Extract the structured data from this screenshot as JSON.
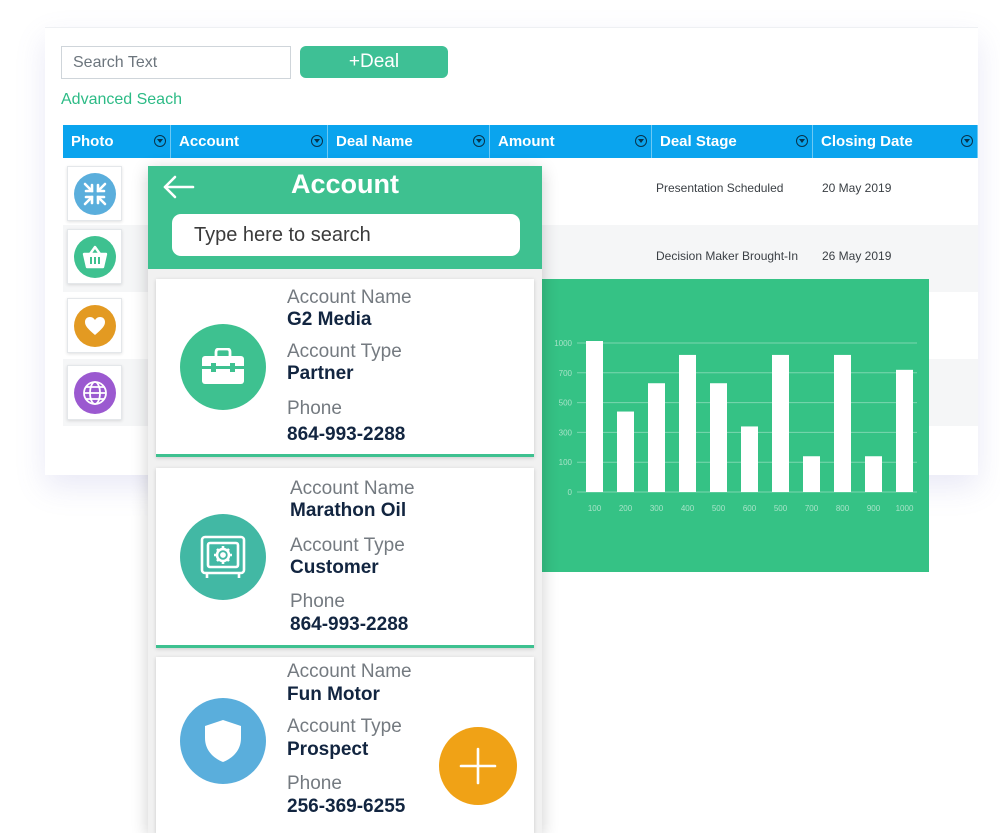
{
  "desktop": {
    "search_placeholder": "Search Text",
    "add_deal_label": "+Deal",
    "advanced_search_label": "Advanced Seach",
    "columns": [
      {
        "label": "Photo"
      },
      {
        "label": "Account"
      },
      {
        "label": "Deal Name"
      },
      {
        "label": "Amount"
      },
      {
        "label": "Deal Stage"
      },
      {
        "label": "Closing Date"
      }
    ],
    "rows": [
      {
        "icon": "arrows-icon",
        "color": "#5aaedc",
        "deal_stage": "Presentation Scheduled",
        "closing_date": "20 May 2019"
      },
      {
        "icon": "basket-icon",
        "color": "#3ec190",
        "deal_stage": "Decision Maker Brought-In",
        "closing_date": "26 May 2019"
      },
      {
        "icon": "heart-icon",
        "color": "#e39a22",
        "deal_stage": "",
        "closing_date": ""
      },
      {
        "icon": "globe-icon",
        "color": "#9b59d0",
        "deal_stage": "",
        "closing_date": ""
      }
    ]
  },
  "chart_data": {
    "type": "bar",
    "categories": [
      "100",
      "200",
      "300",
      "400",
      "500",
      "600",
      "500",
      "700",
      "800",
      "900",
      "1000"
    ],
    "values": [
      1020,
      540,
      730,
      920,
      730,
      440,
      920,
      240,
      920,
      240,
      820
    ],
    "y_ticks": [
      "0",
      "100",
      "300",
      "500",
      "700",
      "1000"
    ],
    "ylim": [
      0,
      1000
    ],
    "grid": true,
    "bar_color": "#ffffff",
    "background": "#35c285"
  },
  "mobile": {
    "title": "Account",
    "search_placeholder": "Type here to search",
    "labels": {
      "account_name": "Account Name",
      "account_type": "Account Type",
      "phone": "Phone"
    },
    "cards": [
      {
        "name": "G2 Media",
        "type": "Partner",
        "phone": "864-993-2288",
        "icon": "briefcase-icon",
        "color": "#3ec190"
      },
      {
        "name": "Marathon Oil",
        "type": "Customer",
        "phone": "864-993-2288",
        "icon": "safe-icon",
        "color": "#42b8a4"
      },
      {
        "name": "Fun Motor",
        "type": "Prospect",
        "phone": "256-369-6255",
        "icon": "shield-icon",
        "color": "#5aaedc"
      }
    ],
    "fab_color": "#f0a216"
  }
}
